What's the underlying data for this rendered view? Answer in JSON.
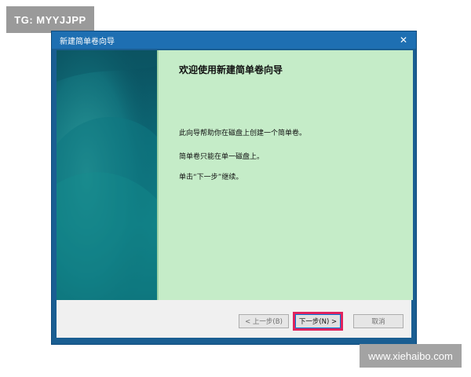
{
  "watermarks": {
    "top_left": "TG: MYYJJPP",
    "bottom_right": "www.xiehaibo.com"
  },
  "window": {
    "title": "新建简单卷向导",
    "close_glyph": "✕"
  },
  "content": {
    "heading": "欢迎使用新建简单卷向导",
    "paragraphs": [
      "此向导帮助你在磁盘上创建一个简单卷。",
      "简单卷只能在单一磁盘上。",
      "单击“下一步”继续。"
    ]
  },
  "buttons": {
    "back": "< 上一步(B)",
    "next": "下一步(N) >",
    "cancel": "取消"
  },
  "colors": {
    "highlight": "#e0245e",
    "content_bg": "#c5ecc8",
    "titlebar": "#1e6fb2"
  }
}
